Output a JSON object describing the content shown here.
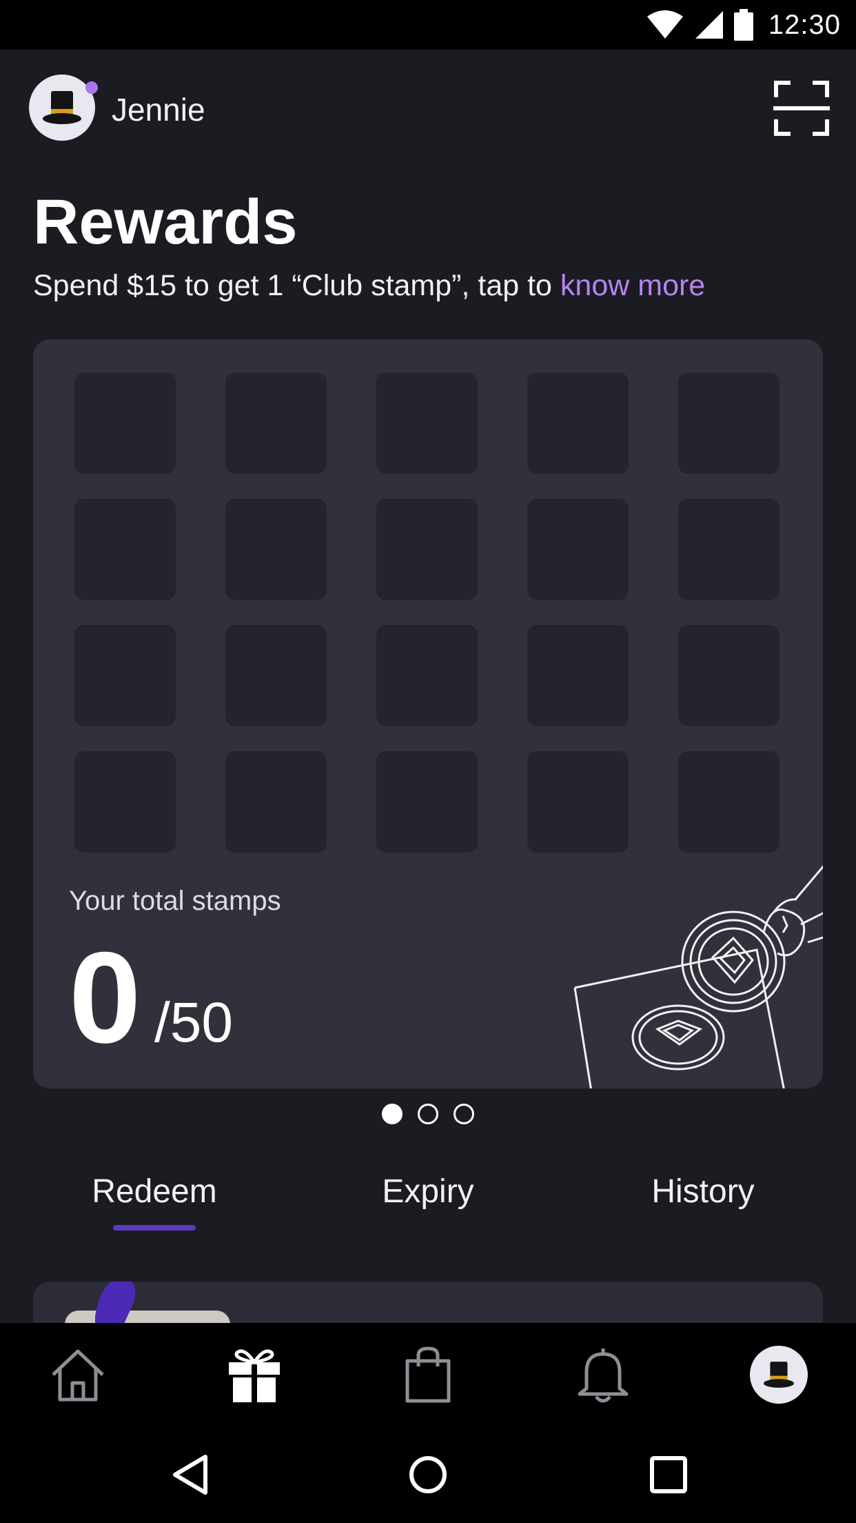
{
  "status_bar": {
    "time": "12:30"
  },
  "header": {
    "user_name": "Jennie",
    "avatar_icon": "top-hat-icon",
    "scan_icon": "scan-frame-icon"
  },
  "page": {
    "title": "Rewards",
    "subtitle_prefix": "Spend $15 to get 1 “Club stamp”, tap to ",
    "subtitle_link": "know more"
  },
  "stamps": {
    "label": "Your total stamps",
    "count": "0",
    "max": "/50",
    "slots": 20
  },
  "pager": {
    "pages": 3,
    "active": 0
  },
  "tabs": [
    {
      "label": "Redeem",
      "active": true
    },
    {
      "label": "Expiry",
      "active": false
    },
    {
      "label": "History",
      "active": false
    }
  ],
  "bottom_nav": [
    {
      "icon": "home-icon"
    },
    {
      "icon": "gift-icon",
      "active": true
    },
    {
      "icon": "shopping-bag-icon"
    },
    {
      "icon": "bell-icon"
    },
    {
      "icon": "profile-avatar-icon"
    }
  ],
  "colors": {
    "background": "#1b1b22",
    "card": "#31313b",
    "slot": "#24242c",
    "accent_link": "#b982f0",
    "tab_underline": "#5b3ac4"
  }
}
